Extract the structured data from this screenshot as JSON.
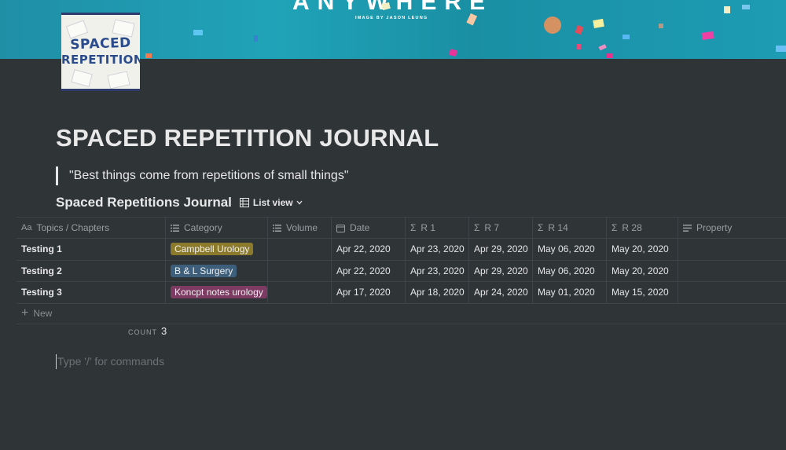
{
  "cover": {
    "title": "ANYWHERE",
    "credit": "IMAGE BY JASON LEUNG",
    "colors": {
      "base": "#1f9fb4"
    }
  },
  "page_icon": {
    "line1": "SPACED",
    "line2": "REPETITION",
    "icon": "spaced-repetition-logo"
  },
  "page": {
    "title": "SPACED REPETITION JOURNAL",
    "quote": "\"Best things come from repetitions of small things\""
  },
  "database": {
    "title": "Spaced Repetitions Journal",
    "view_label": "List view",
    "columns": [
      {
        "label": "Topics / Chapters",
        "icon": "text-aa-icon"
      },
      {
        "label": "Category",
        "icon": "list-icon"
      },
      {
        "label": "Volume",
        "icon": "list-icon"
      },
      {
        "label": "Date",
        "icon": "calendar-icon"
      },
      {
        "label": "R 1",
        "icon": "sigma-icon"
      },
      {
        "label": "R 7",
        "icon": "sigma-icon"
      },
      {
        "label": "R 14",
        "icon": "sigma-icon"
      },
      {
        "label": "R 28",
        "icon": "sigma-icon"
      },
      {
        "label": "Property",
        "icon": "lines-icon"
      }
    ],
    "rows": [
      {
        "title": "Testing 1",
        "category": "Campbell Urology",
        "category_color": "#8c7a2c",
        "volume": "",
        "date": "Apr 22, 2020",
        "r1": "Apr 23, 2020",
        "r7": "Apr 29, 2020",
        "r14": "May 06, 2020",
        "r28": "May 20, 2020",
        "property": ""
      },
      {
        "title": "Testing 2",
        "category": "B & L Surgery",
        "category_color": "#3e5f7c",
        "volume": "",
        "date": "Apr 22, 2020",
        "r1": "Apr 23, 2020",
        "r7": "Apr 29, 2020",
        "r14": "May 06, 2020",
        "r28": "May 20, 2020",
        "property": ""
      },
      {
        "title": "Testing 3",
        "category": "Koncpt notes urology",
        "category_color": "#7d3a62",
        "volume": "",
        "date": "Apr 17, 2020",
        "r1": "Apr 18, 2020",
        "r7": "Apr 24, 2020",
        "r14": "May 01, 2020",
        "r28": "May 15, 2020",
        "property": ""
      }
    ],
    "new_label": "New",
    "count_label": "COUNT",
    "count_value": "3"
  },
  "editor": {
    "placeholder": "Type '/' for commands"
  }
}
